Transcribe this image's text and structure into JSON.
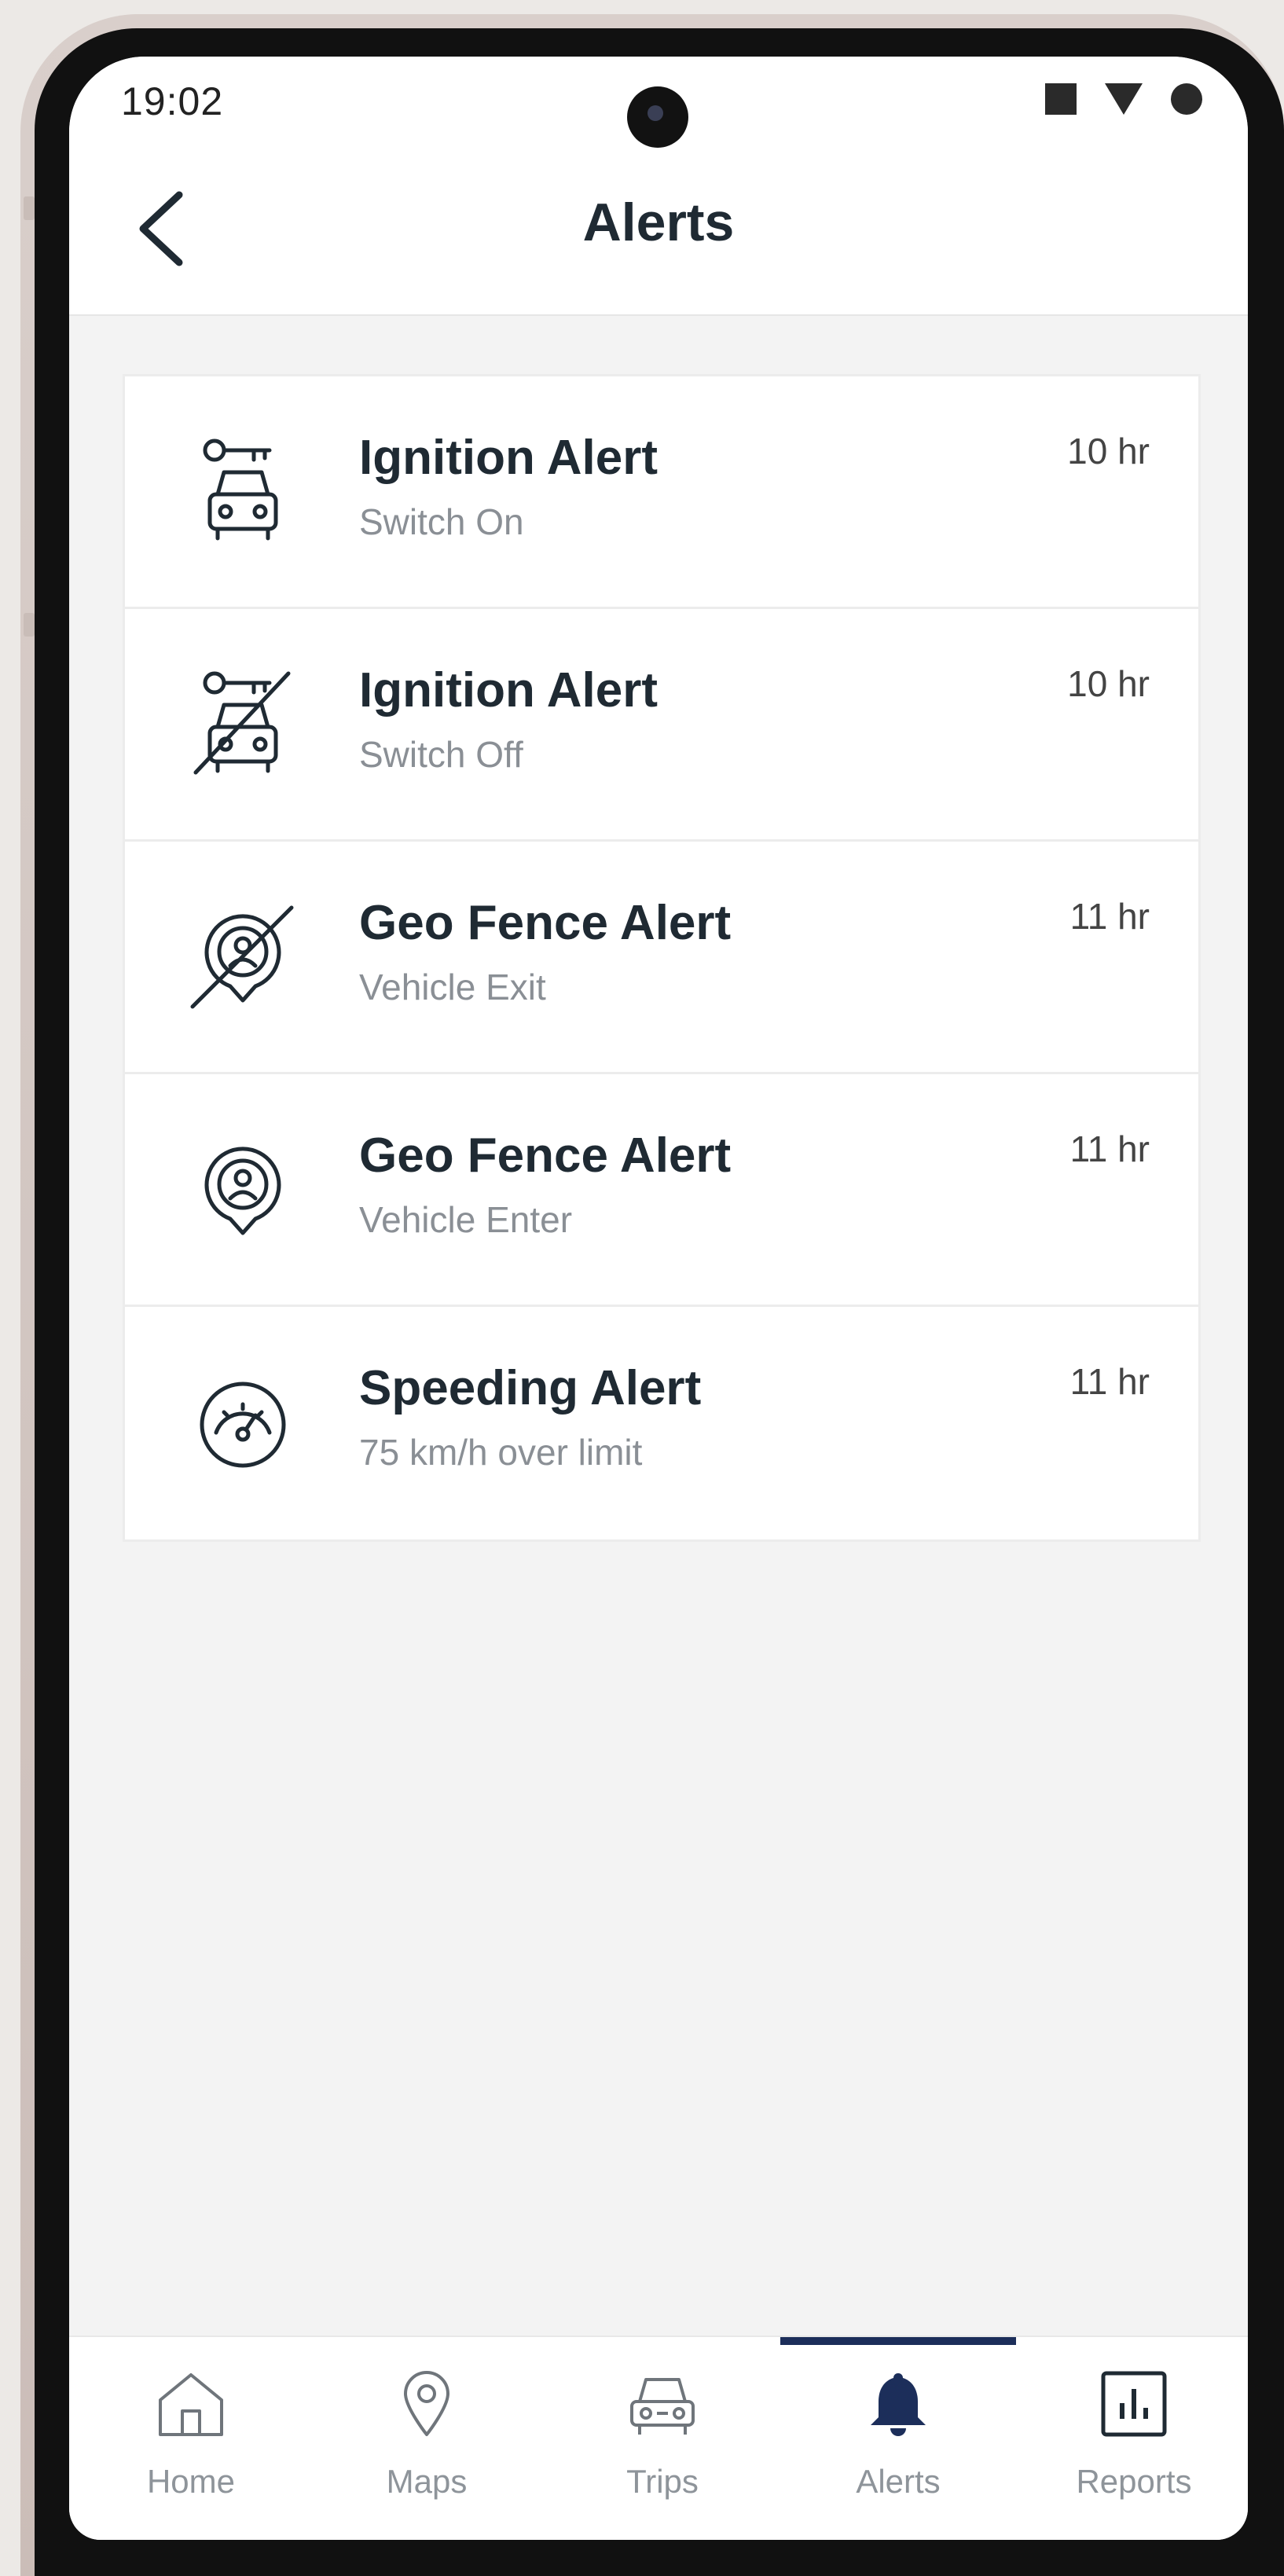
{
  "status_bar": {
    "time": "19:02"
  },
  "header": {
    "title": "Alerts",
    "back_icon": "chevron-left-icon"
  },
  "alerts": [
    {
      "title": "Ignition Alert",
      "subtitle": "Switch On",
      "time": "10 hr",
      "icon": "car-key-icon"
    },
    {
      "title": "Ignition Alert",
      "subtitle": "Switch Off",
      "time": "10 hr",
      "icon": "car-key-off-icon"
    },
    {
      "title": "Geo Fence Alert",
      "subtitle": "Vehicle Exit",
      "time": "11 hr",
      "icon": "geofence-exit-icon"
    },
    {
      "title": "Geo Fence Alert",
      "subtitle": "Vehicle Enter",
      "time": "11 hr",
      "icon": "geofence-enter-icon"
    },
    {
      "title": "Speeding Alert",
      "subtitle": "75 km/h over limit",
      "time": "11 hr",
      "icon": "speedometer-icon"
    }
  ],
  "bottom_nav": {
    "active": "Alerts",
    "accent_color": "#1c2e5a",
    "items": [
      {
        "label": "Home",
        "icon": "home-icon"
      },
      {
        "label": "Maps",
        "icon": "map-pin-icon"
      },
      {
        "label": "Trips",
        "icon": "car-icon"
      },
      {
        "label": "Alerts",
        "icon": "bell-icon"
      },
      {
        "label": "Reports",
        "icon": "chart-icon"
      }
    ]
  }
}
